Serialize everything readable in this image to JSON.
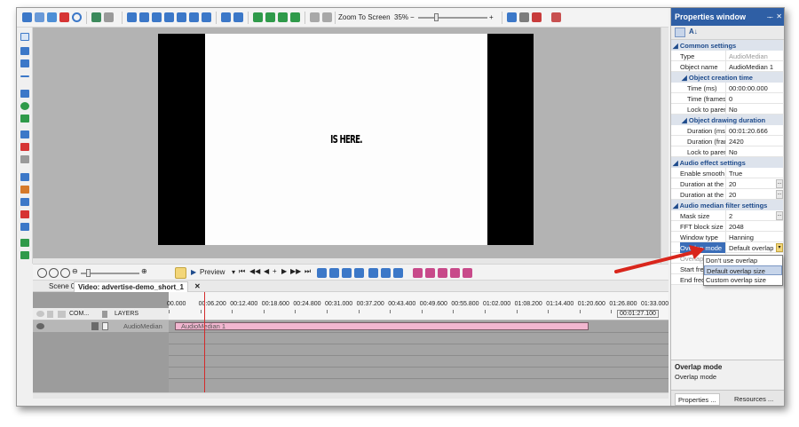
{
  "toolbar": {
    "zoom_to_screen": "Zoom To Screen",
    "zoom_level": "35%"
  },
  "canvas": {
    "video_text": "IS HERE."
  },
  "timeline_toolbar": {
    "preview_label": "Preview"
  },
  "tabs": [
    {
      "label": "Scene 0"
    },
    {
      "label": "Video: advertise-demo_short_1"
    }
  ],
  "timeline": {
    "columns": {
      "com": "COM...",
      "layers": "LAYERS"
    },
    "ruler_ticks": [
      "00.000",
      "00:06.200",
      "00:12.400",
      "00:18.600",
      "00:24.800",
      "00:31.000",
      "00:37.200",
      "00:43.400",
      "00:49.600",
      "00:55.800",
      "01:02.000",
      "01:08.200",
      "01:14.400",
      "01:20.600",
      "01:26.800",
      "01:33.000"
    ],
    "end_time": "00:01:27.100",
    "row_name": "AudioMedian",
    "clip_label": "AudioMedian 1"
  },
  "properties": {
    "title": "Properties window",
    "common_settings": "Common settings",
    "type_label": "Type",
    "type_value": "AudioMedian",
    "object_name_label": "Object name",
    "object_name_value": "AudioMedian 1",
    "creation_section": "Object creation time",
    "time_ms_label": "Time (ms)",
    "time_ms_value": "00:00:00.000",
    "time_frames_label": "Time (frames)",
    "time_frames_value": "0",
    "lock_parent1_label": "Lock to parent",
    "lock_parent1_value": "No",
    "drawing_section": "Object drawing duration",
    "duration_ms_label": "Duration (ms)",
    "duration_ms_value": "00:01:20.666",
    "duration_fr_label": "Duration (frames)",
    "duration_fr_value": "2420",
    "lock_parent2_label": "Lock to parent",
    "lock_parent2_value": "No",
    "audio_effect_section": "Audio effect settings",
    "enable_smooth_label": "Enable smooth",
    "enable_smooth_value": "True",
    "duration_begin_label": "Duration at the beginning",
    "duration_begin_value": "20",
    "duration_end_label": "Duration at the end",
    "duration_end_value": "20",
    "median_section": "Audio median filter settings",
    "mask_size_label": "Mask size",
    "mask_size_value": "2",
    "fft_label": "FFT block size",
    "fft_value": "2048",
    "window_type_label": "Window type",
    "window_type_value": "Hanning",
    "overlap_mode_label": "Overlap mode",
    "overlap_mode_value": "Default overlap",
    "overlap_size_label": "Overlap size",
    "start_freq_label": "Start frequency",
    "end_freq_label": "End frequency",
    "dropdown_options": [
      "Don't use overlap",
      "Default overlap size",
      "Custom overlap size"
    ],
    "desc_title": "Overlap mode",
    "desc_text": "Overlap mode",
    "bottom_tabs": [
      "Properties ...",
      "Resources ..."
    ]
  }
}
